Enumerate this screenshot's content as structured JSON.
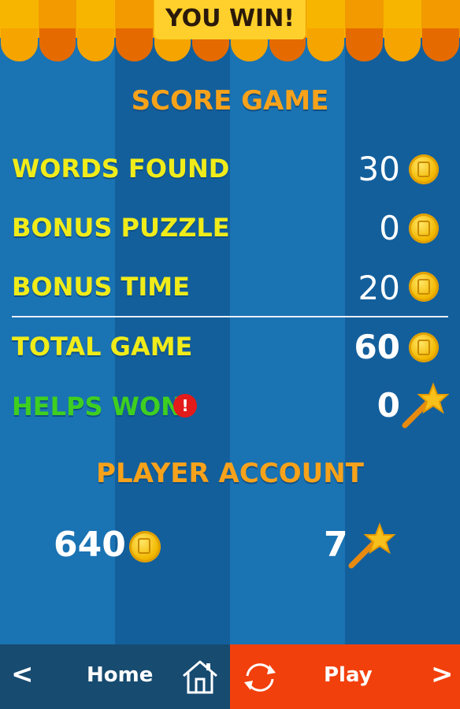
{
  "header": {
    "title": "YOU WIN!"
  },
  "score": {
    "title": "SCORE GAME",
    "rows": [
      {
        "label": "WORDS FOUND",
        "value": "30"
      },
      {
        "label": "BONUS PUZZLE",
        "value": "0"
      },
      {
        "label": "BONUS TIME",
        "value": "20"
      },
      {
        "label": "TOTAL GAME",
        "value": "60"
      },
      {
        "label": "HELPS WON",
        "value": "0"
      }
    ],
    "alert": "!"
  },
  "account": {
    "title": "PLAYER ACCOUNT",
    "coins": "640",
    "helps": "7"
  },
  "footer": {
    "home_label": "Home",
    "play_label": "Play",
    "prev_glyph": "<",
    "next_glyph": ">"
  },
  "colors": {
    "accent_orange": "#f7a21b",
    "label_yellow": "#f0ec1a",
    "label_green": "#3ecf20",
    "play_bg": "#f2400c",
    "home_bg": "#174b70"
  }
}
